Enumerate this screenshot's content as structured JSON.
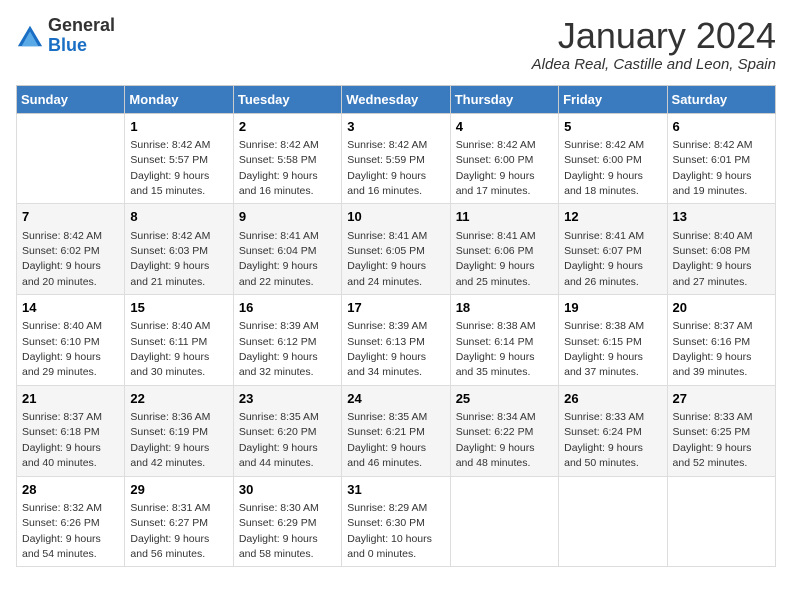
{
  "logo": {
    "general": "General",
    "blue": "Blue"
  },
  "title": "January 2024",
  "location": "Aldea Real, Castille and Leon, Spain",
  "days_header": [
    "Sunday",
    "Monday",
    "Tuesday",
    "Wednesday",
    "Thursday",
    "Friday",
    "Saturday"
  ],
  "weeks": [
    [
      {
        "num": "",
        "sunrise": "",
        "sunset": "",
        "daylight": ""
      },
      {
        "num": "1",
        "sunrise": "Sunrise: 8:42 AM",
        "sunset": "Sunset: 5:57 PM",
        "daylight": "Daylight: 9 hours and 15 minutes."
      },
      {
        "num": "2",
        "sunrise": "Sunrise: 8:42 AM",
        "sunset": "Sunset: 5:58 PM",
        "daylight": "Daylight: 9 hours and 16 minutes."
      },
      {
        "num": "3",
        "sunrise": "Sunrise: 8:42 AM",
        "sunset": "Sunset: 5:59 PM",
        "daylight": "Daylight: 9 hours and 16 minutes."
      },
      {
        "num": "4",
        "sunrise": "Sunrise: 8:42 AM",
        "sunset": "Sunset: 6:00 PM",
        "daylight": "Daylight: 9 hours and 17 minutes."
      },
      {
        "num": "5",
        "sunrise": "Sunrise: 8:42 AM",
        "sunset": "Sunset: 6:00 PM",
        "daylight": "Daylight: 9 hours and 18 minutes."
      },
      {
        "num": "6",
        "sunrise": "Sunrise: 8:42 AM",
        "sunset": "Sunset: 6:01 PM",
        "daylight": "Daylight: 9 hours and 19 minutes."
      }
    ],
    [
      {
        "num": "7",
        "sunrise": "Sunrise: 8:42 AM",
        "sunset": "Sunset: 6:02 PM",
        "daylight": "Daylight: 9 hours and 20 minutes."
      },
      {
        "num": "8",
        "sunrise": "Sunrise: 8:42 AM",
        "sunset": "Sunset: 6:03 PM",
        "daylight": "Daylight: 9 hours and 21 minutes."
      },
      {
        "num": "9",
        "sunrise": "Sunrise: 8:41 AM",
        "sunset": "Sunset: 6:04 PM",
        "daylight": "Daylight: 9 hours and 22 minutes."
      },
      {
        "num": "10",
        "sunrise": "Sunrise: 8:41 AM",
        "sunset": "Sunset: 6:05 PM",
        "daylight": "Daylight: 9 hours and 24 minutes."
      },
      {
        "num": "11",
        "sunrise": "Sunrise: 8:41 AM",
        "sunset": "Sunset: 6:06 PM",
        "daylight": "Daylight: 9 hours and 25 minutes."
      },
      {
        "num": "12",
        "sunrise": "Sunrise: 8:41 AM",
        "sunset": "Sunset: 6:07 PM",
        "daylight": "Daylight: 9 hours and 26 minutes."
      },
      {
        "num": "13",
        "sunrise": "Sunrise: 8:40 AM",
        "sunset": "Sunset: 6:08 PM",
        "daylight": "Daylight: 9 hours and 27 minutes."
      }
    ],
    [
      {
        "num": "14",
        "sunrise": "Sunrise: 8:40 AM",
        "sunset": "Sunset: 6:10 PM",
        "daylight": "Daylight: 9 hours and 29 minutes."
      },
      {
        "num": "15",
        "sunrise": "Sunrise: 8:40 AM",
        "sunset": "Sunset: 6:11 PM",
        "daylight": "Daylight: 9 hours and 30 minutes."
      },
      {
        "num": "16",
        "sunrise": "Sunrise: 8:39 AM",
        "sunset": "Sunset: 6:12 PM",
        "daylight": "Daylight: 9 hours and 32 minutes."
      },
      {
        "num": "17",
        "sunrise": "Sunrise: 8:39 AM",
        "sunset": "Sunset: 6:13 PM",
        "daylight": "Daylight: 9 hours and 34 minutes."
      },
      {
        "num": "18",
        "sunrise": "Sunrise: 8:38 AM",
        "sunset": "Sunset: 6:14 PM",
        "daylight": "Daylight: 9 hours and 35 minutes."
      },
      {
        "num": "19",
        "sunrise": "Sunrise: 8:38 AM",
        "sunset": "Sunset: 6:15 PM",
        "daylight": "Daylight: 9 hours and 37 minutes."
      },
      {
        "num": "20",
        "sunrise": "Sunrise: 8:37 AM",
        "sunset": "Sunset: 6:16 PM",
        "daylight": "Daylight: 9 hours and 39 minutes."
      }
    ],
    [
      {
        "num": "21",
        "sunrise": "Sunrise: 8:37 AM",
        "sunset": "Sunset: 6:18 PM",
        "daylight": "Daylight: 9 hours and 40 minutes."
      },
      {
        "num": "22",
        "sunrise": "Sunrise: 8:36 AM",
        "sunset": "Sunset: 6:19 PM",
        "daylight": "Daylight: 9 hours and 42 minutes."
      },
      {
        "num": "23",
        "sunrise": "Sunrise: 8:35 AM",
        "sunset": "Sunset: 6:20 PM",
        "daylight": "Daylight: 9 hours and 44 minutes."
      },
      {
        "num": "24",
        "sunrise": "Sunrise: 8:35 AM",
        "sunset": "Sunset: 6:21 PM",
        "daylight": "Daylight: 9 hours and 46 minutes."
      },
      {
        "num": "25",
        "sunrise": "Sunrise: 8:34 AM",
        "sunset": "Sunset: 6:22 PM",
        "daylight": "Daylight: 9 hours and 48 minutes."
      },
      {
        "num": "26",
        "sunrise": "Sunrise: 8:33 AM",
        "sunset": "Sunset: 6:24 PM",
        "daylight": "Daylight: 9 hours and 50 minutes."
      },
      {
        "num": "27",
        "sunrise": "Sunrise: 8:33 AM",
        "sunset": "Sunset: 6:25 PM",
        "daylight": "Daylight: 9 hours and 52 minutes."
      }
    ],
    [
      {
        "num": "28",
        "sunrise": "Sunrise: 8:32 AM",
        "sunset": "Sunset: 6:26 PM",
        "daylight": "Daylight: 9 hours and 54 minutes."
      },
      {
        "num": "29",
        "sunrise": "Sunrise: 8:31 AM",
        "sunset": "Sunset: 6:27 PM",
        "daylight": "Daylight: 9 hours and 56 minutes."
      },
      {
        "num": "30",
        "sunrise": "Sunrise: 8:30 AM",
        "sunset": "Sunset: 6:29 PM",
        "daylight": "Daylight: 9 hours and 58 minutes."
      },
      {
        "num": "31",
        "sunrise": "Sunrise: 8:29 AM",
        "sunset": "Sunset: 6:30 PM",
        "daylight": "Daylight: 10 hours and 0 minutes."
      },
      {
        "num": "",
        "sunrise": "",
        "sunset": "",
        "daylight": ""
      },
      {
        "num": "",
        "sunrise": "",
        "sunset": "",
        "daylight": ""
      },
      {
        "num": "",
        "sunrise": "",
        "sunset": "",
        "daylight": ""
      }
    ]
  ]
}
